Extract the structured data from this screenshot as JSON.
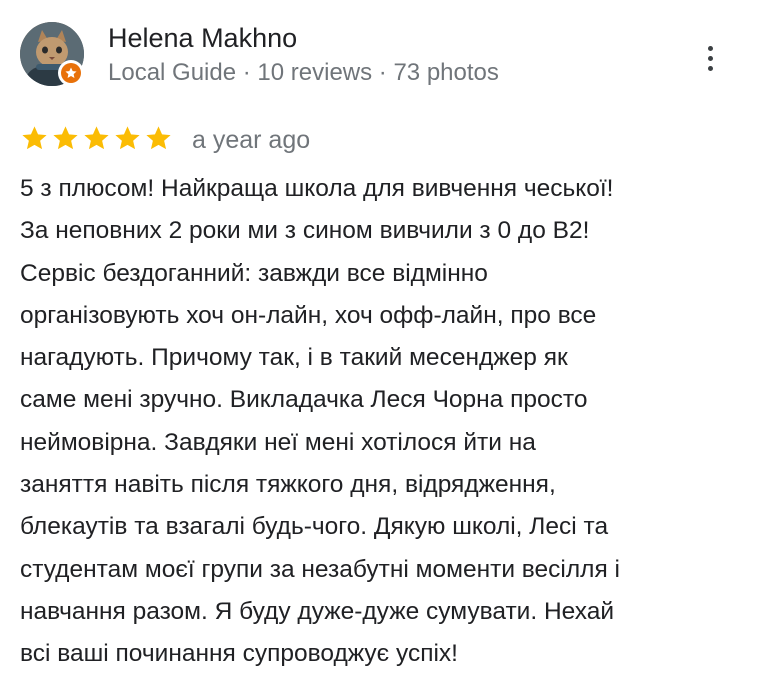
{
  "reviewer": {
    "name": "Helena Makhno",
    "meta": "Local Guide · 10 reviews · 73 photos",
    "avatar_icon": "cat-avatar",
    "badge_icon": "local-guide-star-badge"
  },
  "actions": {
    "more_icon": "more-vert-icon"
  },
  "rating": {
    "stars": 5,
    "max": 5,
    "color": "#fbbc04"
  },
  "time": "a year ago",
  "review_lines": [
    "5 з плюсом! Найкраща школа для вивчення чеської!",
    "За неповних 2 роки ми з сином вивчили з 0 до В2!",
    "Сервіс бездоганний: завжди все відмінно",
    "організовують хоч он-лайн, хоч офф-лайн, про все",
    "нагадують. Причому так, і в такий месенджер як",
    "саме мені зручно. Викладачка Леся Чорна просто",
    "неймовірна. Завдяки неї мені хотілося йти на",
    "заняття навіть після тяжкого дня, відрядження,",
    "блекаутів та взагалі будь-чого. Дякую школі, Лесі та",
    "студентам моєї групи за незабутні моменти весілля і",
    "навчання разом. Я буду дуже-дуже сумувати. Нехай",
    "всі ваші починання супроводжує успіх!"
  ]
}
